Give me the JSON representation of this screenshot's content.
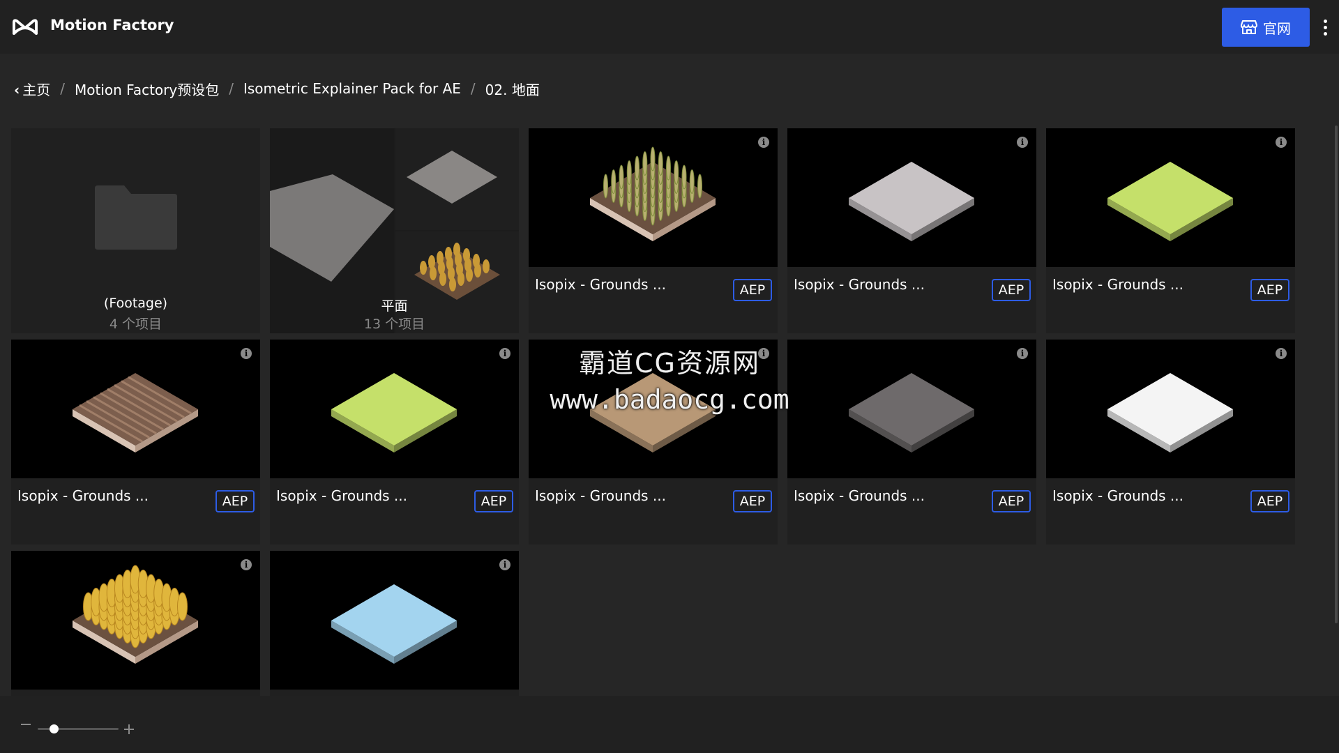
{
  "header": {
    "app_title": "Motion Factory",
    "site_button_label": "官网",
    "icons": [
      "motion-factory-logo",
      "store-icon",
      "more-vertical-icon"
    ]
  },
  "breadcrumb": {
    "items": [
      "主页",
      "Motion Factory预设包",
      "Isometric Explainer Pack for AE",
      "02. 地面"
    ]
  },
  "grid": {
    "folders": [
      {
        "title": "(Footage)",
        "count": "4 个项目"
      },
      {
        "title": "平面",
        "count": "13 个项目"
      }
    ],
    "assets": [
      {
        "name": "Isopix - Grounds ...",
        "badge": "AEP",
        "thumb": "grass-field",
        "top_color": "#a0a060"
      },
      {
        "name": "Isopix - Grounds ...",
        "badge": "AEP",
        "thumb": "tile",
        "top_color": "#c8c3c5"
      },
      {
        "name": "Isopix - Grounds ...",
        "badge": "AEP",
        "thumb": "tile",
        "top_color": "#c5e06a"
      },
      {
        "name": "Isopix - Grounds ...",
        "badge": "AEP",
        "thumb": "plowed",
        "top_color": "#8a6b59"
      },
      {
        "name": "Isopix - Grounds ...",
        "badge": "AEP",
        "thumb": "tile",
        "top_color": "#c5e06a"
      },
      {
        "name": "Isopix - Grounds ...",
        "badge": "AEP",
        "thumb": "tile",
        "top_color": "#b89876"
      },
      {
        "name": "Isopix - Grounds ...",
        "badge": "AEP",
        "thumb": "tile",
        "top_color": "#6e6a6b"
      },
      {
        "name": "Isopix - Grounds ...",
        "badge": "AEP",
        "thumb": "tile",
        "top_color": "#f4f4f4"
      },
      {
        "name": "",
        "badge": "",
        "thumb": "wheat-field",
        "top_color": "#e0b63c"
      },
      {
        "name": "",
        "badge": "",
        "thumb": "tile",
        "top_color": "#a3d4ef"
      }
    ]
  },
  "watermark": {
    "line1": "霸道CG资源网",
    "line2": "www.badaocg.com"
  },
  "footer": {
    "zoom_level": 0.2
  }
}
